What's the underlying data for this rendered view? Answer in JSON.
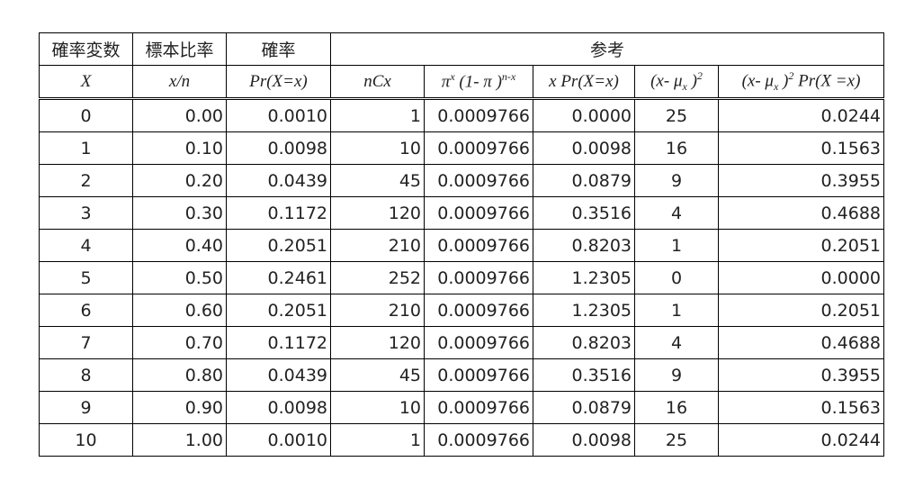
{
  "header": {
    "row1": {
      "rv": "確率変数",
      "ratio": "標本比率",
      "prob": "確率",
      "ref": "参考"
    },
    "row2": {
      "x": "X",
      "xn": "x/n",
      "pr": "Pr(X=x)",
      "ncx": "nCx",
      "pi_a": "π",
      "pi_sup": "x",
      "pi_b": " (1- π )",
      "pi_sup2": "n-x",
      "xpr": "x Pr(X=x)",
      "dev_a": "(x- μ",
      "dev_sub": "x",
      "dev_b": " )",
      "dev_sup": "2",
      "vpr_a": "(x- μ",
      "vpr_sub": "x",
      "vpr_b": " )",
      "vpr_sup": "2",
      "vpr_c": " Pr(X =x)"
    }
  },
  "rows": [
    [
      "0",
      "0.00",
      "0.0010",
      "1",
      "0.0009766",
      "0.0000",
      "25",
      "0.0244"
    ],
    [
      "1",
      "0.10",
      "0.0098",
      "10",
      "0.0009766",
      "0.0098",
      "16",
      "0.1563"
    ],
    [
      "2",
      "0.20",
      "0.0439",
      "45",
      "0.0009766",
      "0.0879",
      "9",
      "0.3955"
    ],
    [
      "3",
      "0.30",
      "0.1172",
      "120",
      "0.0009766",
      "0.3516",
      "4",
      "0.4688"
    ],
    [
      "4",
      "0.40",
      "0.2051",
      "210",
      "0.0009766",
      "0.8203",
      "1",
      "0.2051"
    ],
    [
      "5",
      "0.50",
      "0.2461",
      "252",
      "0.0009766",
      "1.2305",
      "0",
      "0.0000"
    ],
    [
      "6",
      "0.60",
      "0.2051",
      "210",
      "0.0009766",
      "1.2305",
      "1",
      "0.2051"
    ],
    [
      "7",
      "0.70",
      "0.1172",
      "120",
      "0.0009766",
      "0.8203",
      "4",
      "0.4688"
    ],
    [
      "8",
      "0.80",
      "0.0439",
      "45",
      "0.0009766",
      "0.3516",
      "9",
      "0.3955"
    ],
    [
      "9",
      "0.90",
      "0.0098",
      "10",
      "0.0009766",
      "0.0879",
      "16",
      "0.1563"
    ],
    [
      "10",
      "1.00",
      "0.0010",
      "1",
      "0.0009766",
      "0.0098",
      "25",
      "0.0244"
    ]
  ]
}
